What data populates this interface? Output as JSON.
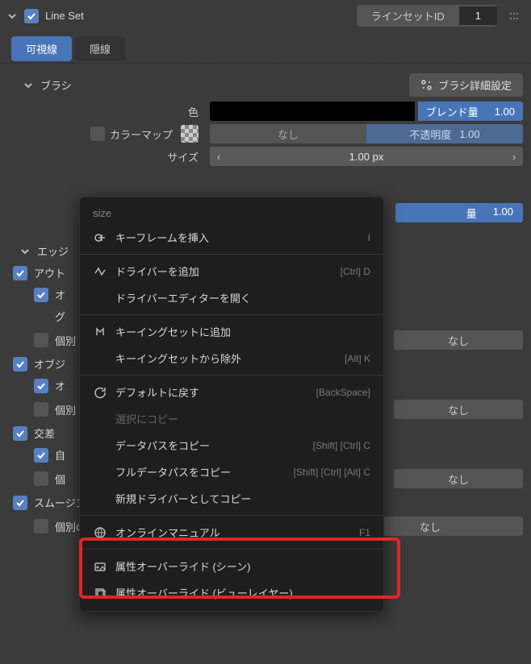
{
  "header": {
    "title": "Line Set",
    "id_label": "ラインセットID",
    "id_value": "1"
  },
  "tabs": {
    "visible": "可視線",
    "hidden": "隠線"
  },
  "brush": {
    "section": "ブラシ",
    "detail_button": "ブラシ詳細設定",
    "color_label": "色",
    "blend_label": "ブレンド量",
    "blend_value": "1.00",
    "colormap_label": "カラーマップ",
    "colormap_value": "なし",
    "opacity_label": "不透明度",
    "opacity_value": "1.00",
    "size_label": "サイズ",
    "size_value": "1.00 px",
    "size_amount_label": "量",
    "size_amount_value": "1.00"
  },
  "edge": {
    "section": "エッジ",
    "outline": "アウト",
    "outline_o": "オ",
    "outline_gu": "グ",
    "outline_indiv": "個別",
    "object": "オブジ",
    "object_o": "オ",
    "object_indiv": "個別",
    "intersect": "交差",
    "intersect_self": "自",
    "intersect_indiv": "個",
    "smoothing": "スムージング境界",
    "indiv_brush": "個別のブラシ設定",
    "none": "なし"
  },
  "ctx": {
    "title": "size",
    "insert_keyframe": "キーフレームを挿入",
    "insert_keyframe_sc": "I",
    "add_driver": "ドライバーを追加",
    "add_driver_sc": "[Ctrl] D",
    "open_driver_editor": "ドライバーエディターを開く",
    "add_keyingset": "キーイングセットに追加",
    "remove_keyingset": "キーイングセットから除外",
    "remove_keyingset_sc": "[Alt] K",
    "reset_default": "デフォルトに戻す",
    "reset_default_sc": "[BackSpace]",
    "copy_to_selected": "選択にコピー",
    "copy_data_path": "データパスをコピー",
    "copy_data_path_sc": "[Shift] [Ctrl] C",
    "copy_full_data_path": "フルデータパスをコピー",
    "copy_full_data_path_sc": "[Shift] [Ctrl] [Alt] C",
    "copy_as_new_driver": "新規ドライバーとしてコピー",
    "online_manual": "オンラインマニュアル",
    "online_manual_sc": "F1",
    "override_scene": "属性オーバーライド (シーン)",
    "override_viewlayer": "属性オーバーライド (ビューレイヤー)"
  }
}
